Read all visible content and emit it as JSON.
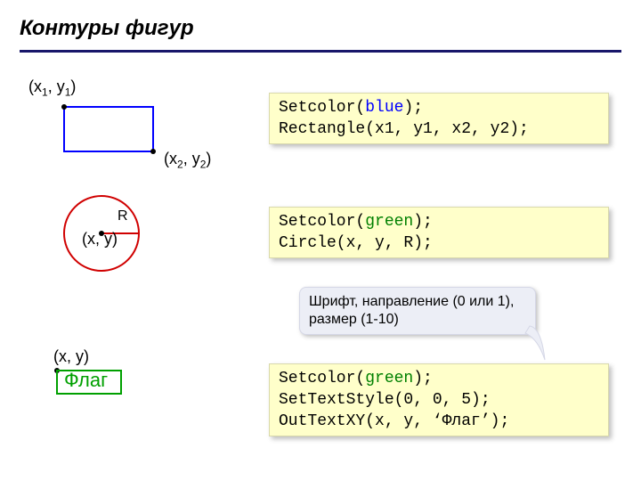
{
  "title": "Контуры фигур",
  "labels": {
    "p1_x": "(x",
    "p1_sub": "1",
    "p1_mid": ", y",
    "p1_sub2": "1",
    "p1_end": ")",
    "p2_x": "(x",
    "p2_sub": "2",
    "p2_mid": ", y",
    "p2_sub2": "2",
    "p2_end": ")",
    "pxy": "(x, y)",
    "r": "R",
    "flag_word": "Флаг"
  },
  "code1": {
    "l1a": "Setcolor(",
    "l1b": "blue",
    "l1c": ");",
    "l2": "Rectangle(x1, y1, x2, y2);"
  },
  "code2": {
    "l1a": "Setcolor(",
    "l1b": "green",
    "l1c": ");",
    "l2": "Circle(x, y, R);"
  },
  "callout": {
    "line1": "Шрифт, направление (0 или 1),",
    "line2": "размер (1-10)"
  },
  "code3": {
    "l1a": "Setcolor(",
    "l1b": "green",
    "l1c": ");",
    "l2": "SetTextStyle(0, 0, 5);",
    "l3": "OutTextXY(x, y, ‘Флаг’);"
  }
}
